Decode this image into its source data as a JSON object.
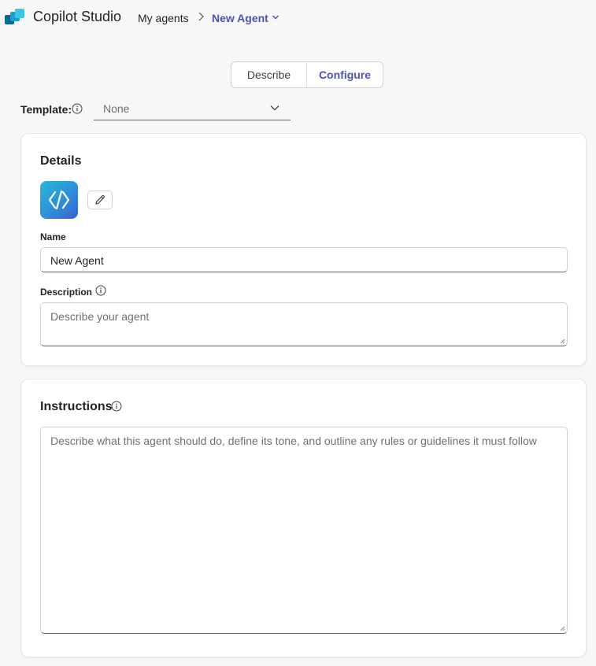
{
  "header": {
    "app_title": "Copilot Studio",
    "breadcrumb": {
      "parent": "My agents",
      "current": "New Agent"
    }
  },
  "tabs": [
    {
      "label": "Describe",
      "selected": false
    },
    {
      "label": "Configure",
      "selected": true
    }
  ],
  "template": {
    "label": "Template:",
    "value": "None"
  },
  "details": {
    "title": "Details",
    "name_label": "Name",
    "name_value": "New Agent",
    "description_label": "Description",
    "description_placeholder": "Describe your agent"
  },
  "instructions": {
    "title": "Instructions",
    "placeholder": "Describe what this agent should do, define its tone, and outline any rules or guidelines it must follow"
  },
  "colors": {
    "accent": "#4f52b2",
    "page_background": "#f7f7f7",
    "agent_icon_gradient": [
      "#27b8d8",
      "#3a5fd1"
    ]
  },
  "icons": {
    "logo": "copilot-studio-logo",
    "breadcrumb_separator": "chevron-right-icon",
    "agent_menu": "chevron-down-icon",
    "template_dropdown": "chevron-down-icon",
    "info": "info-icon",
    "edit": "pencil-icon",
    "agent": "code-brackets-icon"
  }
}
